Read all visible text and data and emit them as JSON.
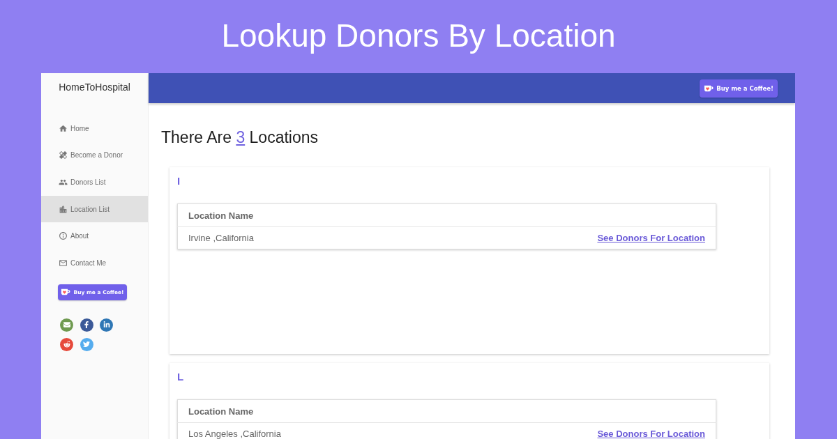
{
  "banner": {
    "title": "Lookup Donors By Location"
  },
  "sidebar": {
    "brand": "HomeToHospital",
    "items": [
      {
        "label": "Home",
        "selected": false
      },
      {
        "label": "Become a Donor",
        "selected": false
      },
      {
        "label": "Donors List",
        "selected": false
      },
      {
        "label": "Location List",
        "selected": true
      },
      {
        "label": "About",
        "selected": false
      },
      {
        "label": "Contact Me",
        "selected": false
      }
    ],
    "coffee_button": "Buy me a Coffee!",
    "social_links": [
      {
        "kind": "email",
        "color": "#6f9a50"
      },
      {
        "kind": "facebook",
        "color": "#3b5998"
      },
      {
        "kind": "linkedin",
        "color": "#2f77b5"
      },
      {
        "kind": "reddit",
        "color": "#e64a3b"
      },
      {
        "kind": "twitter",
        "color": "#55acee"
      }
    ]
  },
  "topbar": {
    "coffee_button": "Buy me a Coffee!"
  },
  "content": {
    "heading": {
      "prefix": "There Are",
      "count": "3",
      "suffix": "Locations"
    },
    "groups": [
      {
        "letter": "I",
        "columns": [
          "Location Name"
        ],
        "rows": [
          {
            "name": "Irvine ,California",
            "link": "See Donors For Location"
          }
        ]
      },
      {
        "letter": "L",
        "columns": [
          "Location Name"
        ],
        "rows": [
          {
            "name": "Los Angeles ,California",
            "link": "See Donors For Location"
          }
        ]
      }
    ]
  }
}
